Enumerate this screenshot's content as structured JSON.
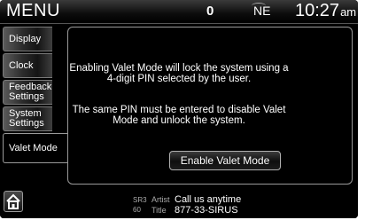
{
  "header": {
    "title": "MENU",
    "count": "0",
    "compass": "NE",
    "time": "10:27",
    "ampm": "am"
  },
  "tabs": [
    {
      "label": "Display"
    },
    {
      "label": "Clock"
    },
    {
      "label_line1": "Feedback",
      "label_line2": "Settings"
    },
    {
      "label_line1": "System",
      "label_line2": "Settings"
    },
    {
      "label": "Valet Mode"
    }
  ],
  "panel": {
    "message1_line1": "Enabling Valet Mode will lock the system using a",
    "message1_line2": "4-digit PIN selected by the user.",
    "message2_line1": "The same PIN must be entered to disable Valet",
    "message2_line2": "Mode and unlock the system.",
    "button_label": "Enable Valet Mode"
  },
  "now_playing": {
    "source": "SR3",
    "channel": "60",
    "artist_label": "Artist",
    "artist": "Call us anytime",
    "title_label": "Title",
    "title": "877-33-SIRUS"
  },
  "icons": {
    "home": "home-icon"
  }
}
